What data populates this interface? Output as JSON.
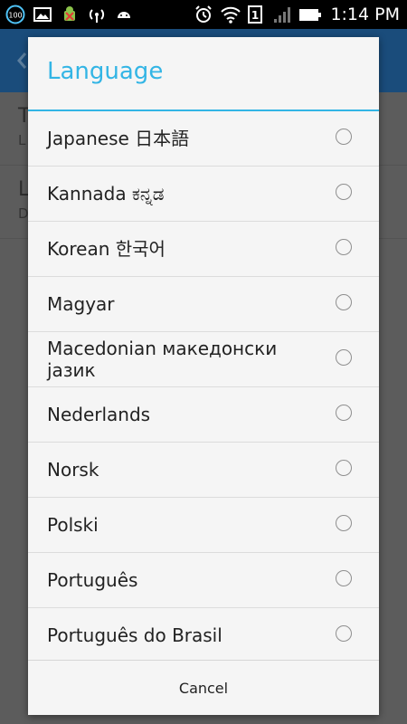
{
  "status_bar": {
    "battery_level_label": "100",
    "time": "1:14 PM",
    "sim_slot": "1",
    "icons_left": [
      "battery-saver-icon",
      "image-icon",
      "android-debug-icon",
      "wifi-hotspot-icon",
      "android-icon"
    ],
    "icons_right": [
      "alarm-icon",
      "wifi-icon",
      "sim-icon",
      "signal-icon",
      "battery-icon"
    ]
  },
  "background_app": {
    "rows": [
      {
        "title": "T",
        "subtitle": "L"
      },
      {
        "title": "L",
        "subtitle": "D"
      }
    ]
  },
  "dialog": {
    "title": "Language",
    "accent_color": "#33b5e5",
    "options": [
      {
        "label": "Japanese 日本語",
        "selected": false
      },
      {
        "label": "Kannada ಕನ್ನಡ",
        "selected": false
      },
      {
        "label": "Korean 한국어",
        "selected": false
      },
      {
        "label": "Magyar",
        "selected": false
      },
      {
        "label": "Macedonian македонски јазик",
        "selected": false
      },
      {
        "label": "Nederlands",
        "selected": false
      },
      {
        "label": "Norsk",
        "selected": false
      },
      {
        "label": "Polski",
        "selected": false
      },
      {
        "label": "Português",
        "selected": false
      },
      {
        "label": "Português do Brasil",
        "selected": false
      }
    ],
    "cancel_label": "Cancel"
  }
}
